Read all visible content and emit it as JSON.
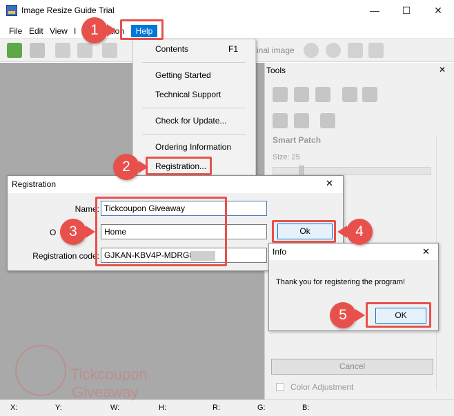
{
  "window": {
    "title": "Image Resize Guide Trial",
    "minimize": "—",
    "maximize": "☐",
    "close": "✕"
  },
  "menubar": {
    "items": [
      "File",
      "Edit",
      "View",
      "I",
      "ation"
    ],
    "help": "Help"
  },
  "toolbar": {
    "label": "inal image"
  },
  "help_menu": {
    "contents": "Contents",
    "contents_shortcut": "F1",
    "getting_started": "Getting Started",
    "technical_support": "Technical Support",
    "check_updates": "Check for Update...",
    "ordering": "Ordering Information",
    "registration": "Registration..."
  },
  "tools": {
    "title": "Tools",
    "close": "✕",
    "smart_patch": "Smart Patch",
    "size_label": "Size: 25",
    "cancel": "Cancel",
    "color_adjustment": "Color Adjustment"
  },
  "registration": {
    "title": "Registration",
    "close": "✕",
    "name_label": "Name:",
    "name_value": "Tickcoupon Giveaway",
    "org_label": "O",
    "org_value": "Home",
    "code_label": "Registration code:",
    "code_value": "GJKAN-KBV4P-MDRG8-",
    "ok": "Ok"
  },
  "info": {
    "title": "Info",
    "close": "✕",
    "message": "Thank you for registering the program!",
    "ok": "OK"
  },
  "status": {
    "x": "X:",
    "y": "Y:",
    "w": "W:",
    "h": "H:",
    "r": "R:",
    "g": "G:",
    "b": "B:"
  },
  "annotations": {
    "step1": "1",
    "step2": "2",
    "step3": "3",
    "step4": "4",
    "step5": "5",
    "accent": "#e8504b"
  },
  "watermark": {
    "line1": "Tickcoupon",
    "line2": "Giveaway"
  }
}
